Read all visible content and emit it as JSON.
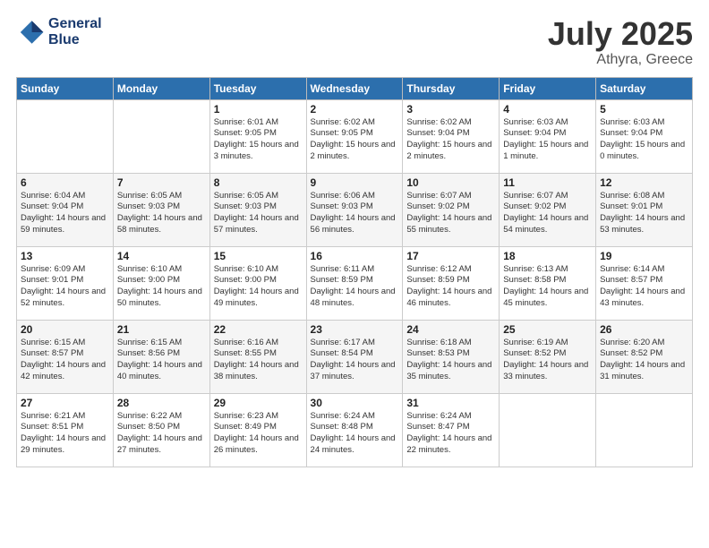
{
  "logo": {
    "line1": "General",
    "line2": "Blue"
  },
  "title": "July 2025",
  "location": "Athyra, Greece",
  "days_header": [
    "Sunday",
    "Monday",
    "Tuesday",
    "Wednesday",
    "Thursday",
    "Friday",
    "Saturday"
  ],
  "weeks": [
    [
      {
        "day": "",
        "sunrise": "",
        "sunset": "",
        "daylight": ""
      },
      {
        "day": "",
        "sunrise": "",
        "sunset": "",
        "daylight": ""
      },
      {
        "day": "1",
        "sunrise": "Sunrise: 6:01 AM",
        "sunset": "Sunset: 9:05 PM",
        "daylight": "Daylight: 15 hours and 3 minutes."
      },
      {
        "day": "2",
        "sunrise": "Sunrise: 6:02 AM",
        "sunset": "Sunset: 9:05 PM",
        "daylight": "Daylight: 15 hours and 2 minutes."
      },
      {
        "day": "3",
        "sunrise": "Sunrise: 6:02 AM",
        "sunset": "Sunset: 9:04 PM",
        "daylight": "Daylight: 15 hours and 2 minutes."
      },
      {
        "day": "4",
        "sunrise": "Sunrise: 6:03 AM",
        "sunset": "Sunset: 9:04 PM",
        "daylight": "Daylight: 15 hours and 1 minute."
      },
      {
        "day": "5",
        "sunrise": "Sunrise: 6:03 AM",
        "sunset": "Sunset: 9:04 PM",
        "daylight": "Daylight: 15 hours and 0 minutes."
      }
    ],
    [
      {
        "day": "6",
        "sunrise": "Sunrise: 6:04 AM",
        "sunset": "Sunset: 9:04 PM",
        "daylight": "Daylight: 14 hours and 59 minutes."
      },
      {
        "day": "7",
        "sunrise": "Sunrise: 6:05 AM",
        "sunset": "Sunset: 9:03 PM",
        "daylight": "Daylight: 14 hours and 58 minutes."
      },
      {
        "day": "8",
        "sunrise": "Sunrise: 6:05 AM",
        "sunset": "Sunset: 9:03 PM",
        "daylight": "Daylight: 14 hours and 57 minutes."
      },
      {
        "day": "9",
        "sunrise": "Sunrise: 6:06 AM",
        "sunset": "Sunset: 9:03 PM",
        "daylight": "Daylight: 14 hours and 56 minutes."
      },
      {
        "day": "10",
        "sunrise": "Sunrise: 6:07 AM",
        "sunset": "Sunset: 9:02 PM",
        "daylight": "Daylight: 14 hours and 55 minutes."
      },
      {
        "day": "11",
        "sunrise": "Sunrise: 6:07 AM",
        "sunset": "Sunset: 9:02 PM",
        "daylight": "Daylight: 14 hours and 54 minutes."
      },
      {
        "day": "12",
        "sunrise": "Sunrise: 6:08 AM",
        "sunset": "Sunset: 9:01 PM",
        "daylight": "Daylight: 14 hours and 53 minutes."
      }
    ],
    [
      {
        "day": "13",
        "sunrise": "Sunrise: 6:09 AM",
        "sunset": "Sunset: 9:01 PM",
        "daylight": "Daylight: 14 hours and 52 minutes."
      },
      {
        "day": "14",
        "sunrise": "Sunrise: 6:10 AM",
        "sunset": "Sunset: 9:00 PM",
        "daylight": "Daylight: 14 hours and 50 minutes."
      },
      {
        "day": "15",
        "sunrise": "Sunrise: 6:10 AM",
        "sunset": "Sunset: 9:00 PM",
        "daylight": "Daylight: 14 hours and 49 minutes."
      },
      {
        "day": "16",
        "sunrise": "Sunrise: 6:11 AM",
        "sunset": "Sunset: 8:59 PM",
        "daylight": "Daylight: 14 hours and 48 minutes."
      },
      {
        "day": "17",
        "sunrise": "Sunrise: 6:12 AM",
        "sunset": "Sunset: 8:59 PM",
        "daylight": "Daylight: 14 hours and 46 minutes."
      },
      {
        "day": "18",
        "sunrise": "Sunrise: 6:13 AM",
        "sunset": "Sunset: 8:58 PM",
        "daylight": "Daylight: 14 hours and 45 minutes."
      },
      {
        "day": "19",
        "sunrise": "Sunrise: 6:14 AM",
        "sunset": "Sunset: 8:57 PM",
        "daylight": "Daylight: 14 hours and 43 minutes."
      }
    ],
    [
      {
        "day": "20",
        "sunrise": "Sunrise: 6:15 AM",
        "sunset": "Sunset: 8:57 PM",
        "daylight": "Daylight: 14 hours and 42 minutes."
      },
      {
        "day": "21",
        "sunrise": "Sunrise: 6:15 AM",
        "sunset": "Sunset: 8:56 PM",
        "daylight": "Daylight: 14 hours and 40 minutes."
      },
      {
        "day": "22",
        "sunrise": "Sunrise: 6:16 AM",
        "sunset": "Sunset: 8:55 PM",
        "daylight": "Daylight: 14 hours and 38 minutes."
      },
      {
        "day": "23",
        "sunrise": "Sunrise: 6:17 AM",
        "sunset": "Sunset: 8:54 PM",
        "daylight": "Daylight: 14 hours and 37 minutes."
      },
      {
        "day": "24",
        "sunrise": "Sunrise: 6:18 AM",
        "sunset": "Sunset: 8:53 PM",
        "daylight": "Daylight: 14 hours and 35 minutes."
      },
      {
        "day": "25",
        "sunrise": "Sunrise: 6:19 AM",
        "sunset": "Sunset: 8:52 PM",
        "daylight": "Daylight: 14 hours and 33 minutes."
      },
      {
        "day": "26",
        "sunrise": "Sunrise: 6:20 AM",
        "sunset": "Sunset: 8:52 PM",
        "daylight": "Daylight: 14 hours and 31 minutes."
      }
    ],
    [
      {
        "day": "27",
        "sunrise": "Sunrise: 6:21 AM",
        "sunset": "Sunset: 8:51 PM",
        "daylight": "Daylight: 14 hours and 29 minutes."
      },
      {
        "day": "28",
        "sunrise": "Sunrise: 6:22 AM",
        "sunset": "Sunset: 8:50 PM",
        "daylight": "Daylight: 14 hours and 27 minutes."
      },
      {
        "day": "29",
        "sunrise": "Sunrise: 6:23 AM",
        "sunset": "Sunset: 8:49 PM",
        "daylight": "Daylight: 14 hours and 26 minutes."
      },
      {
        "day": "30",
        "sunrise": "Sunrise: 6:24 AM",
        "sunset": "Sunset: 8:48 PM",
        "daylight": "Daylight: 14 hours and 24 minutes."
      },
      {
        "day": "31",
        "sunrise": "Sunrise: 6:24 AM",
        "sunset": "Sunset: 8:47 PM",
        "daylight": "Daylight: 14 hours and 22 minutes."
      },
      {
        "day": "",
        "sunrise": "",
        "sunset": "",
        "daylight": ""
      },
      {
        "day": "",
        "sunrise": "",
        "sunset": "",
        "daylight": ""
      }
    ]
  ]
}
